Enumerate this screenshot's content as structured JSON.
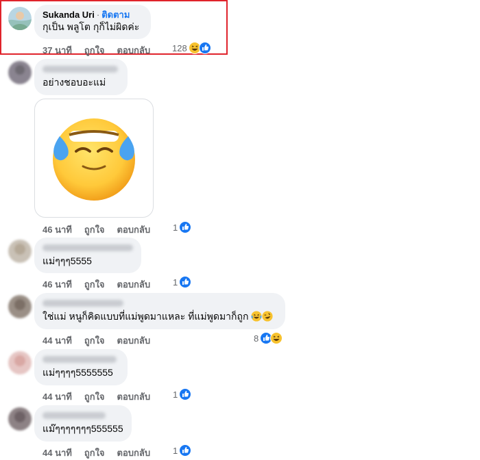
{
  "comments": [
    {
      "author": "Sukanda Uri",
      "follow": "ติดตาม",
      "text": "กุเป็น พลูโต กุก็ไม่ผิดค่ะ",
      "time": "37 นาที",
      "like": "ถูกใจ",
      "reply": "ตอบกลับ",
      "reaction_count": "128",
      "reaction_icons": [
        "haha-icon",
        "like-icon"
      ]
    },
    {
      "author": "",
      "text": "อย่างชอบอะแม่",
      "time": "46 นาที",
      "like": "ถูกใจ",
      "reply": "ตอบกลับ",
      "reaction_count": "1",
      "reaction_icons": [
        "like-icon"
      ],
      "sticker": "laughing-tears-emoji"
    },
    {
      "author": "",
      "text": "แม่ๆๆๆ5555",
      "time": "46 นาที",
      "like": "ถูกใจ",
      "reply": "ตอบกลับ",
      "reaction_count": "1",
      "reaction_icons": [
        "like-icon"
      ]
    },
    {
      "author": "",
      "text": "ใช่แม่ หนูก็คิดแบบที่แม่พูดมาแหละ ที่แม่พูดมาก็ถูก",
      "time": "44 นาที",
      "like": "ถูกใจ",
      "reply": "ตอบกลับ",
      "reaction_count": "8",
      "reaction_icons": [
        "like-icon",
        "haha-icon"
      ]
    },
    {
      "author": "",
      "text": "แม่ๆๆๆๆ5555555",
      "time": "44 นาที",
      "like": "ถูกใจ",
      "reply": "ตอบกลับ",
      "reaction_count": "1",
      "reaction_icons": [
        "like-icon"
      ]
    },
    {
      "author": "",
      "text": "แม๊ๆๆๆๆๆๆๆ555555",
      "time": "44 นาที",
      "like": "ถูกใจ",
      "reply": "ตอบกลับ",
      "reaction_count": "1",
      "reaction_icons": [
        "like-icon"
      ]
    }
  ],
  "colors": {
    "highlight_border": "#e0232b",
    "bubble_bg": "#f0f2f5",
    "follow_blue": "#1877f2",
    "meta_gray": "#65676b"
  }
}
